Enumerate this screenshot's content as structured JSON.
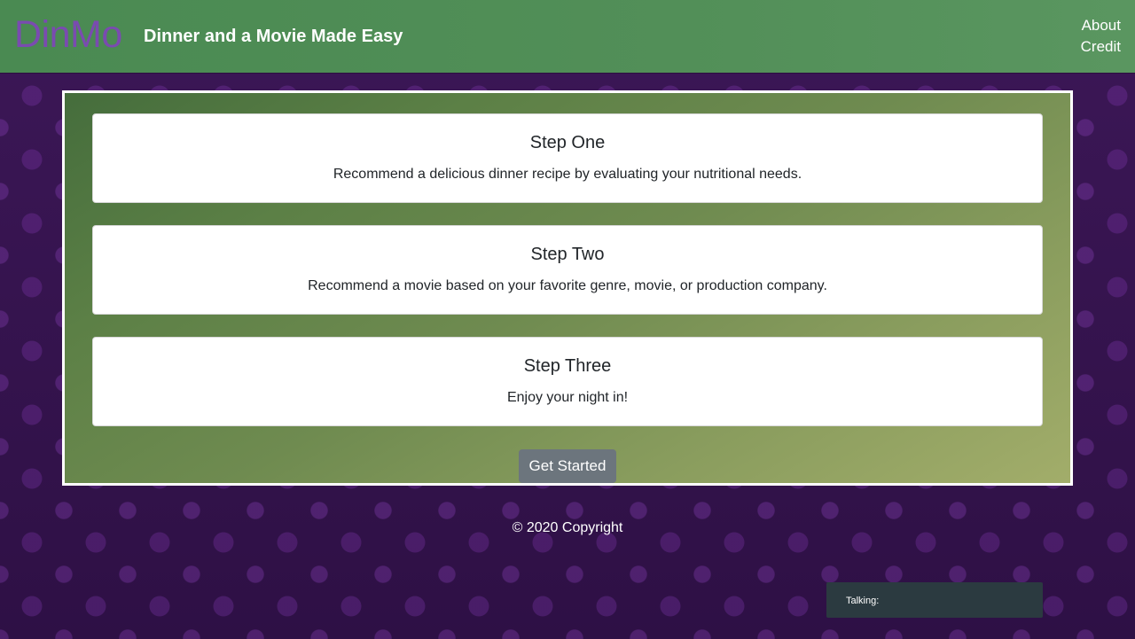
{
  "navbar": {
    "brand": "DinMo",
    "tagline": "Dinner and a Movie Made Easy",
    "links": [
      "About",
      "Credit"
    ]
  },
  "steps": [
    {
      "title": "Step One",
      "description": "Recommend a delicious dinner recipe by evaluating your nutritional needs."
    },
    {
      "title": "Step Two",
      "description": "Recommend a movie based on your favorite genre, movie, or production company."
    },
    {
      "title": "Step Three",
      "description": "Enjoy your night in!"
    }
  ],
  "cta": {
    "label": "Get Started"
  },
  "footer": {
    "copyright": "© 2020 Copyright"
  },
  "chat_widget": {
    "label": "Talking:"
  },
  "colors": {
    "navbar": "#528f58",
    "brand": "#7a4bb0",
    "background": "#3b1655",
    "button": "#6c757d",
    "chat_widget": "#2b3a40"
  }
}
